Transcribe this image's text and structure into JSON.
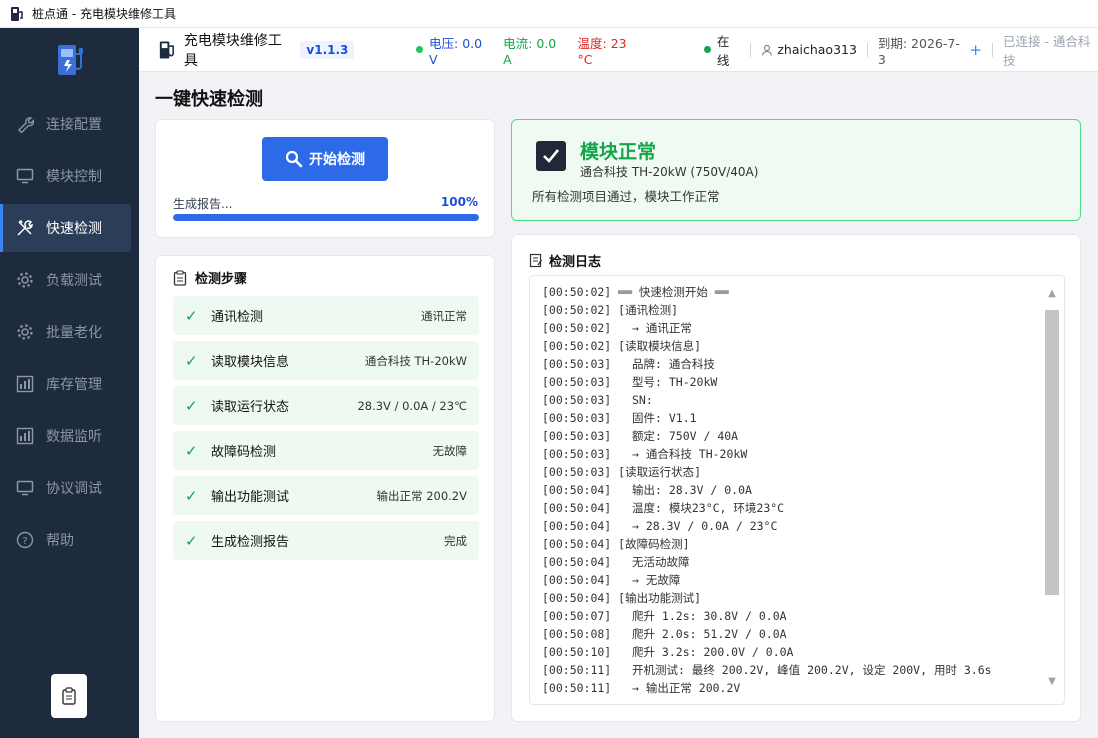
{
  "window": {
    "title": "桩点通 - 充电模块维修工具"
  },
  "sidebar": {
    "items": [
      {
        "label": "连接配置",
        "icon": "wrench-icon"
      },
      {
        "label": "模块控制",
        "icon": "monitor-icon"
      },
      {
        "label": "快速检测",
        "icon": "tools-icon",
        "active": true
      },
      {
        "label": "负载测试",
        "icon": "gear-icon"
      },
      {
        "label": "批量老化",
        "icon": "gear-icon"
      },
      {
        "label": "库存管理",
        "icon": "bar-chart-icon"
      },
      {
        "label": "数据监听",
        "icon": "bar-chart-icon"
      },
      {
        "label": "协议调试",
        "icon": "monitor-icon"
      },
      {
        "label": "帮助",
        "icon": "help-icon"
      }
    ]
  },
  "header": {
    "app_title": "充电模块维修工具",
    "version": "v1.1.3",
    "voltage": "电压: 0.0 V",
    "current": "电流: 0.0 A",
    "temperature": "温度: 23 °C",
    "status": "在线",
    "username": "zhaichao313",
    "expire": "到期: 2026-7-3",
    "plus": "+",
    "connection": "已连接 - 通合科技"
  },
  "page": {
    "title": "一键快速检测"
  },
  "start": {
    "button_label": "开始检测",
    "progress_label": "生成报告...",
    "progress_percent": "100%",
    "progress_value": 1.0
  },
  "steps": {
    "title": "检测步骤",
    "items": [
      {
        "check": "✓",
        "name": "通讯检测",
        "result": "通讯正常"
      },
      {
        "check": "✓",
        "name": "读取模块信息",
        "result": "通合科技 TH-20kW"
      },
      {
        "check": "✓",
        "name": "读取运行状态",
        "result": "28.3V / 0.0A / 23℃"
      },
      {
        "check": "✓",
        "name": "故障码检测",
        "result": "无故障"
      },
      {
        "check": "✓",
        "name": "输出功能测试",
        "result": "输出正常 200.2V"
      },
      {
        "check": "✓",
        "name": "生成检测报告",
        "result": "完成"
      }
    ]
  },
  "result": {
    "title": "模块正常",
    "model": "通合科技 TH-20kW (750V/40A)",
    "message": "所有检测项目通过，模块工作正常"
  },
  "log": {
    "title": "检测日志",
    "lines": [
      "[00:50:02] ══ 快速检测开始 ══",
      "[00:50:02] [通讯检测]",
      "[00:50:02]   → 通讯正常",
      "[00:50:02] [读取模块信息]",
      "[00:50:03]   品牌: 通合科技",
      "[00:50:03]   型号: TH-20kW",
      "[00:50:03]   SN:",
      "[00:50:03]   固件: V1.1",
      "[00:50:03]   额定: 750V / 40A",
      "[00:50:03]   → 通合科技 TH-20kW",
      "[00:50:03] [读取运行状态]",
      "[00:50:04]   输出: 28.3V / 0.0A",
      "[00:50:04]   温度: 模块23°C, 环境23°C",
      "[00:50:04]   → 28.3V / 0.0A / 23°C",
      "[00:50:04] [故障码检测]",
      "[00:50:04]   无活动故障",
      "[00:50:04]   → 无故障",
      "[00:50:04] [输出功能测试]",
      "[00:50:07]   爬升 1.2s: 30.8V / 0.0A",
      "[00:50:08]   爬升 2.0s: 51.2V / 0.0A",
      "[00:50:10]   爬升 3.2s: 200.0V / 0.0A",
      "[00:50:11]   开机测试: 最终 200.2V, 峰值 200.2V, 设定 200V, 用时 3.6s",
      "[00:50:11]   → 输出正常 200.2V"
    ]
  }
}
